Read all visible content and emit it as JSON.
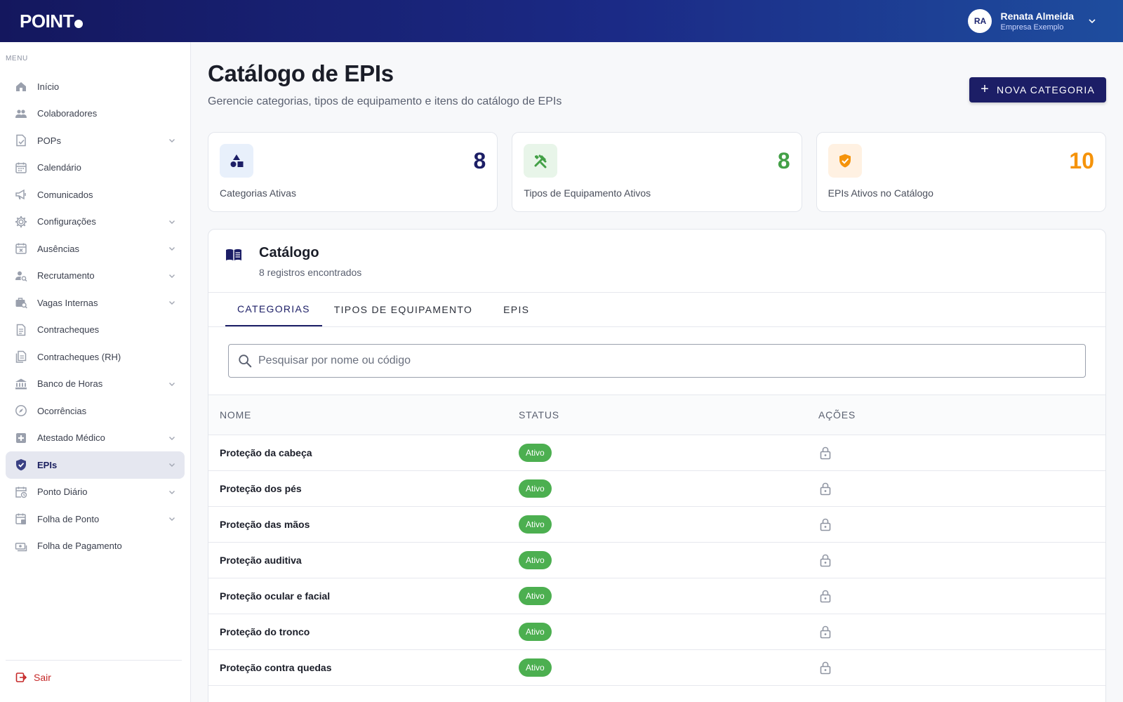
{
  "header": {
    "logo_text": "POINT",
    "user": {
      "initials": "RA",
      "name": "Renata Almeida",
      "company": "Empresa Exemplo"
    }
  },
  "sidebar": {
    "menu_title": "MENU",
    "items": [
      {
        "label": "Início",
        "icon": "home-icon",
        "chevron": false,
        "active": false
      },
      {
        "label": "Colaboradores",
        "icon": "people-icon",
        "chevron": false,
        "active": false
      },
      {
        "label": "POPs",
        "icon": "document-check-icon",
        "chevron": true,
        "active": false
      },
      {
        "label": "Calendário",
        "icon": "calendar-icon",
        "chevron": false,
        "active": false
      },
      {
        "label": "Comunicados",
        "icon": "megaphone-icon",
        "chevron": false,
        "active": false
      },
      {
        "label": "Configurações",
        "icon": "gear-icon",
        "chevron": true,
        "active": false
      },
      {
        "label": "Ausências",
        "icon": "calendar-x-icon",
        "chevron": true,
        "active": false
      },
      {
        "label": "Recrutamento",
        "icon": "person-search-icon",
        "chevron": true,
        "active": false
      },
      {
        "label": "Vagas Internas",
        "icon": "work-search-icon",
        "chevron": true,
        "active": false
      },
      {
        "label": "Contracheques",
        "icon": "receipt-icon",
        "chevron": false,
        "active": false
      },
      {
        "label": "Contracheques (RH)",
        "icon": "receipt-stack-icon",
        "chevron": false,
        "active": false
      },
      {
        "label": "Banco de Horas",
        "icon": "bank-icon",
        "chevron": true,
        "active": false
      },
      {
        "label": "Ocorrências",
        "icon": "compass-icon",
        "chevron": false,
        "active": false
      },
      {
        "label": "Atestado Médico",
        "icon": "medical-icon",
        "chevron": true,
        "active": false
      },
      {
        "label": "EPIs",
        "icon": "shield-check-icon",
        "chevron": true,
        "active": true
      },
      {
        "label": "Ponto Diário",
        "icon": "calendar-clock-icon",
        "chevron": true,
        "active": false
      },
      {
        "label": "Folha de Ponto",
        "icon": "timesheet-icon",
        "chevron": true,
        "active": false
      },
      {
        "label": "Folha de Pagamento",
        "icon": "payments-icon",
        "chevron": false,
        "active": false
      }
    ],
    "logout_label": "Sair"
  },
  "page": {
    "title": "Catálogo de EPIs",
    "subtitle": "Gerencie categorias, tipos de equipamento e itens do catálogo de EPIs",
    "new_button_label": "NOVA CATEGORIA"
  },
  "stats": [
    {
      "value": "8",
      "label": "Categorias Ativas",
      "icon": "shapes-icon",
      "color": "#1c1e66",
      "icon_bg": "#e8f0fb"
    },
    {
      "value": "8",
      "label": "Tipos de Equipamento Ativos",
      "icon": "tools-icon",
      "color": "#43a047",
      "icon_bg": "#e8f5e9"
    },
    {
      "value": "10",
      "label": "EPIs Ativos no Catálogo",
      "icon": "shield-check-icon",
      "color": "#f5930a",
      "icon_bg": "#fff1e2"
    }
  ],
  "catalog": {
    "title": "Catálogo",
    "subtitle": "8 registros encontrados",
    "tabs": [
      {
        "label": "CATEGORIAS",
        "active": true
      },
      {
        "label": "TIPOS DE EQUIPAMENTO",
        "active": false
      },
      {
        "label": "EPIS",
        "active": false
      }
    ],
    "search_placeholder": "Pesquisar por nome ou código",
    "search_value": "",
    "columns": [
      "NOME",
      "STATUS",
      "AÇÕES"
    ],
    "rows": [
      {
        "name": "Proteção da cabeça",
        "status": "Ativo"
      },
      {
        "name": "Proteção dos pés",
        "status": "Ativo"
      },
      {
        "name": "Proteção das mãos",
        "status": "Ativo"
      },
      {
        "name": "Proteção auditiva",
        "status": "Ativo"
      },
      {
        "name": "Proteção ocular e facial",
        "status": "Ativo"
      },
      {
        "name": "Proteção do tronco",
        "status": "Ativo"
      },
      {
        "name": "Proteção contra quedas",
        "status": "Ativo"
      },
      {
        "name": "",
        "status": ""
      }
    ]
  },
  "colors": {
    "primary": "#1c1e66",
    "success": "#4caf50",
    "danger": "#c62828"
  }
}
